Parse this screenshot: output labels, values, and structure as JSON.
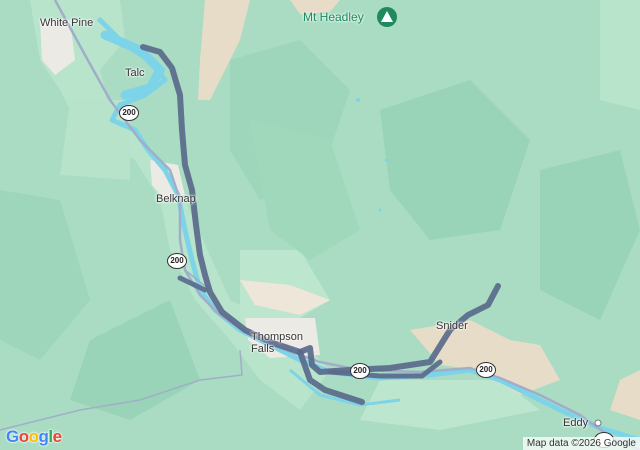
{
  "places": {
    "white_pine": "White Pine",
    "talc": "Talc",
    "belknap": "Belknap",
    "thompson_falls": "Thompson\nFalls",
    "snider": "Snider",
    "eddy": "Eddy",
    "mt_headley": "Mt Headley"
  },
  "routes": {
    "hwy_200": "200"
  },
  "branding": {
    "logo": "Google",
    "attribution": "Map data ©2026 Google"
  },
  "colors": {
    "terrain": "#a8dcc4",
    "water": "#7dd3e8",
    "track": "#5a6a8c",
    "highway": "#a0aec8",
    "peak": "#1e8a5e"
  }
}
